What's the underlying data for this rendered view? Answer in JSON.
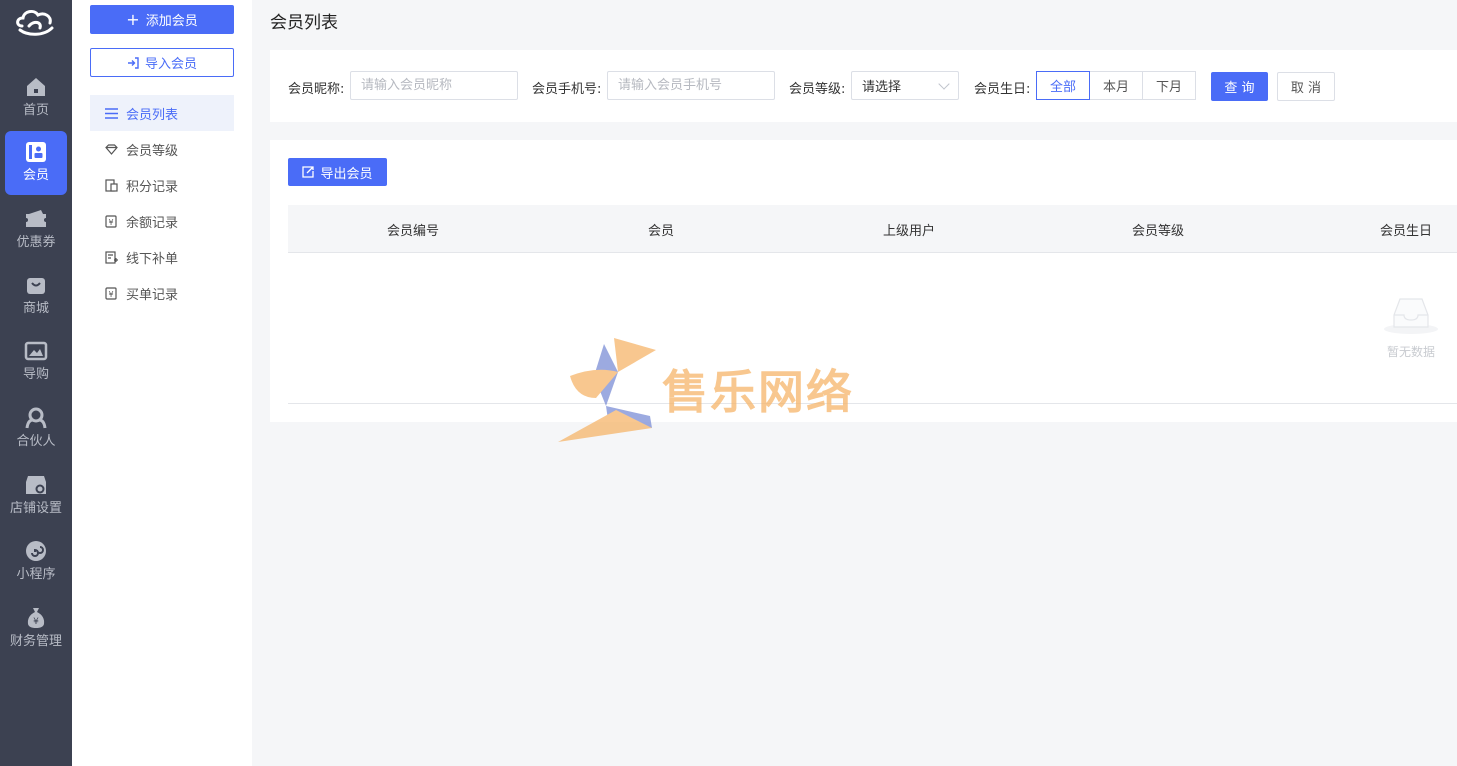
{
  "rail": {
    "items": [
      {
        "label": "首页",
        "icon": "home-icon"
      },
      {
        "label": "会员",
        "icon": "member-card-icon"
      },
      {
        "label": "优惠券",
        "icon": "coupon-icon"
      },
      {
        "label": "商城",
        "icon": "shopping-bag-icon"
      },
      {
        "label": "导购",
        "icon": "image-icon"
      },
      {
        "label": "合伙人",
        "icon": "partner-icon"
      },
      {
        "label": "店铺设置",
        "icon": "store-settings-icon"
      },
      {
        "label": "小程序",
        "icon": "mini-program-icon"
      },
      {
        "label": "财务管理",
        "icon": "finance-icon"
      }
    ],
    "active_index": 1
  },
  "sidebar": {
    "add_button": "添加会员",
    "import_button": "导入会员",
    "items": [
      {
        "label": "会员列表",
        "icon": "list-icon"
      },
      {
        "label": "会员等级",
        "icon": "diamond-icon"
      },
      {
        "label": "积分记录",
        "icon": "points-icon"
      },
      {
        "label": "余额记录",
        "icon": "balance-icon"
      },
      {
        "label": "线下补单",
        "icon": "offline-order-icon"
      },
      {
        "label": "买单记录",
        "icon": "payment-record-icon"
      }
    ],
    "active_index": 0
  },
  "page": {
    "title": "会员列表"
  },
  "filters": {
    "nickname_label": "会员昵称:",
    "nickname_placeholder": "请输入会员昵称",
    "phone_label": "会员手机号:",
    "phone_placeholder": "请输入会员手机号",
    "level_label": "会员等级:",
    "level_value": "请选择",
    "birthday_label": "会员生日:",
    "birthday_options": [
      "全部",
      "本月",
      "下月"
    ],
    "birthday_selected": "全部",
    "query_button": "查 询",
    "cancel_button": "取 消"
  },
  "table": {
    "export_button": "导出会员",
    "columns": [
      "会员编号",
      "会员",
      "上级用户",
      "会员等级",
      "会员生日"
    ],
    "empty_text": "暂无数据"
  },
  "watermark": {
    "text": "售乐网络"
  },
  "colors": {
    "accent": "#4a6cf7",
    "rail_bg": "#3c4151",
    "watermark": "#f6b56a"
  }
}
